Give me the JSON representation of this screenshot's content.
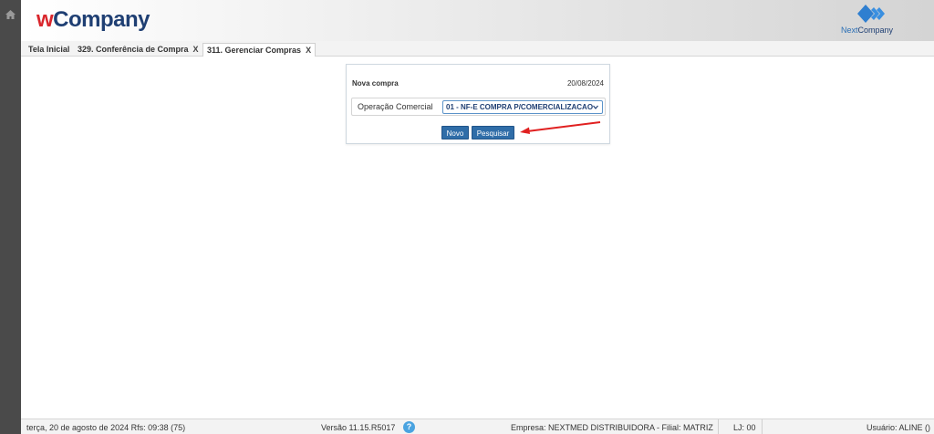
{
  "header": {
    "logo_w": "w",
    "logo_company": "Company",
    "brand_right_next": "Next",
    "brand_right_company": "Company"
  },
  "tabs": [
    {
      "label": "Tela Inicial",
      "closable": false
    },
    {
      "label": "329. Conferência de Compra",
      "closable": true
    },
    {
      "label": "311. Gerenciar Compras",
      "closable": true,
      "active": true
    }
  ],
  "tab_close_glyph": "X",
  "form": {
    "title": "Nova compra",
    "date": "20/08/2024",
    "operacao_label": "Operação Comercial",
    "operacao_value": "01 - NF-E COMPRA P/COMERCIALIZACAO",
    "novo_label": "Novo",
    "pesquisar_label": "Pesquisar"
  },
  "status": {
    "datetime": "terça, 20 de agosto de 2024  Rfs: 09:38 (75)",
    "version": "Versão 11.15.R5017",
    "help": "?",
    "empresa": "Empresa: NEXTMED DISTRIBUIDORA - Filial: MATRIZ",
    "lj": "LJ: 00",
    "usuario": "Usuário: ALINE ()"
  },
  "colors": {
    "sidebar": "#4a4a4a",
    "accent": "#2f6da8",
    "logo_red": "#d9262c",
    "logo_navy": "#1f3f73",
    "arrow": "#e02020"
  }
}
